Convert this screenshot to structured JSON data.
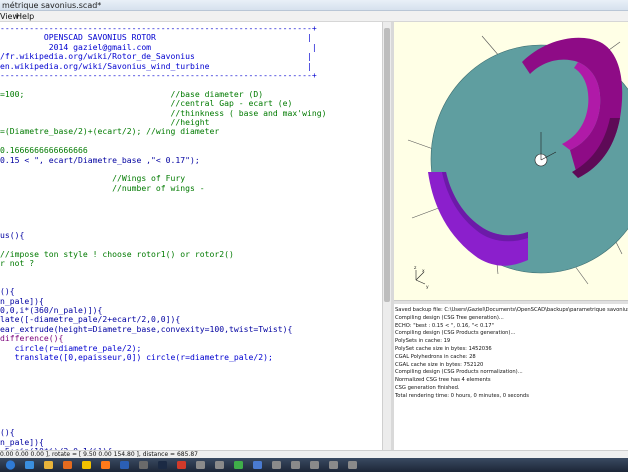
{
  "window": {
    "title": "métrique savonius.scad*"
  },
  "menu": {
    "items": [
      {
        "label": "View"
      },
      {
        "label": "Help"
      }
    ]
  },
  "editor": {
    "lines": [
      {
        "text": "----------------------------------------------------------------+",
        "cls": "c-cm"
      },
      {
        "text": "         OPENSCAD SAVONIUS ROTOR                               |",
        "cls": "c-cm"
      },
      {
        "text": "          2014 gaziel@gmail.com                                 |",
        "cls": "c-cm"
      },
      {
        "text": "/fr.wikipedia.org/wiki/Rotor_de_Savonius                       |",
        "cls": "c-cm"
      },
      {
        "text": "en.wikipedia.org/wiki/Savonius_wind_turbine                    |",
        "cls": "c-cm"
      },
      {
        "text": "----------------------------------------------------------------+",
        "cls": "c-cm"
      },
      {
        "text": "",
        "cls": ""
      },
      {
        "text": "=100;                              //base diameter (D)",
        "cls": "c-gr"
      },
      {
        "text": "                                   //central Gap - ecart (e)",
        "cls": "c-gr"
      },
      {
        "text": "                                   //thinkness ( base and max'wing)",
        "cls": "c-gr"
      },
      {
        "text": "                                   //height",
        "cls": "c-gr"
      },
      {
        "text": "=(Diametre_base/2)+(ecart/2); //wing diameter",
        "cls": "c-gr"
      },
      {
        "text": "",
        "cls": ""
      },
      {
        "text": "0.1666666666666666",
        "cls": "c-gr"
      },
      {
        "text": "0.15 < \", ecart/Diametre_base ,\"< 0.17\");",
        "cls": "c-fn"
      },
      {
        "text": "",
        "cls": ""
      },
      {
        "text": "                       //Wings of Fury",
        "cls": "c-gr"
      },
      {
        "text": "                       //number of wings -",
        "cls": "c-gr"
      },
      {
        "text": "",
        "cls": ""
      },
      {
        "text": "",
        "cls": ""
      },
      {
        "text": "",
        "cls": ""
      },
      {
        "text": "",
        "cls": ""
      },
      {
        "text": "us(){",
        "cls": "c-fn"
      },
      {
        "text": "",
        "cls": ""
      },
      {
        "text": "//impose ton style ! choose rotor1() or rotor2()",
        "cls": "c-gr"
      },
      {
        "text": "r not ?",
        "cls": "c-gr"
      },
      {
        "text": "",
        "cls": ""
      },
      {
        "text": "",
        "cls": ""
      },
      {
        "text": "(){",
        "cls": "c-fn"
      },
      {
        "text": "n_pale]){",
        "cls": "c-fn"
      },
      {
        "text": "0,0,i*(360/n_pale)]){",
        "cls": "c-fn"
      },
      {
        "text": "late([-diametre_pale/2+ecart/2,0,0]){",
        "cls": "c-fn"
      },
      {
        "text": "ear_extrude(height=Diametre_base,convexity=100,twist=Twist){",
        "cls": "c-fn"
      },
      {
        "text": "difference(){",
        "cls": "c-kw"
      },
      {
        "text": "   circle(r=diametre_pale/2);",
        "cls": "c-bl"
      },
      {
        "text": "   translate([0,epaisseur,0]) circle(r=diametre_pale/2);",
        "cls": "c-bl"
      },
      {
        "text": "",
        "cls": ""
      },
      {
        "text": "",
        "cls": ""
      },
      {
        "text": "",
        "cls": ""
      },
      {
        "text": "",
        "cls": ""
      },
      {
        "text": "",
        "cls": ""
      },
      {
        "text": "",
        "cls": ""
      },
      {
        "text": "",
        "cls": ""
      },
      {
        "text": "(){",
        "cls": "c-fn"
      },
      {
        "text": "n_pale]){",
        "cls": "c-fn"
      },
      {
        "text": ".5+sin(10*i)/2,0,1/i]){",
        "cls": "c-fn"
      },
      {
        "text": "([0,0,i*(360/n_pale)]){",
        "cls": "c-fn"
      }
    ]
  },
  "console": {
    "lines": [
      "Saved backup file: C:\\Users\\Gaziel\\Documents\\OpenSCAD\\backups\\parametrique savonius-backup-fjtUvzR.sc",
      "Compiling design (CSG Tree generation)...",
      "ECHO: \"best : 0.15 < \", 0.16, \"< 0.17\"",
      "Compiling design (CSG Products generation)...",
      "PolySets in cache: 19",
      "PolySet cache size in bytes: 1452036",
      "CGAL Polyhedrons in cache: 28",
      "CGAL cache size in bytes: 752120",
      "Compiling design (CSG Products normalization)...",
      "Normalized CSG tree has 4 elements",
      "CSG generation finished.",
      "Total rendering time: 0 hours, 0 minutes, 0 seconds"
    ]
  },
  "status": {
    "text": "0.00 0.00 0.00 ], rotate = [ 9.50 0.00 154.80 ], distance = 685.87"
  },
  "axes": {
    "x": "x",
    "y": "y",
    "z": "z"
  },
  "colors": {
    "viewport_bg": "#ffffe6",
    "base_disc": "#5f9ea0",
    "wing_purple": "#8b1fcc",
    "wing_magenta": "#8e0b86"
  },
  "taskbar": {
    "buttons": [
      {
        "icon": "start-orb-icon"
      },
      {
        "icon": "ie-browser-icon"
      },
      {
        "icon": "folder-icon"
      },
      {
        "icon": "firefox-icon"
      },
      {
        "icon": "openscad-icon"
      },
      {
        "icon": "media-player-icon"
      },
      {
        "icon": "word-icon"
      },
      {
        "icon": "settings-icon"
      },
      {
        "icon": "steam-icon"
      },
      {
        "icon": "paint-icon"
      },
      {
        "icon": "app-icon"
      },
      {
        "icon": "app-icon"
      },
      {
        "icon": "chrome-icon"
      },
      {
        "icon": "network-icon"
      },
      {
        "icon": "app-icon"
      },
      {
        "icon": "app-icon"
      },
      {
        "icon": "app-icon"
      },
      {
        "icon": "app-icon"
      },
      {
        "icon": "app-icon"
      }
    ]
  }
}
